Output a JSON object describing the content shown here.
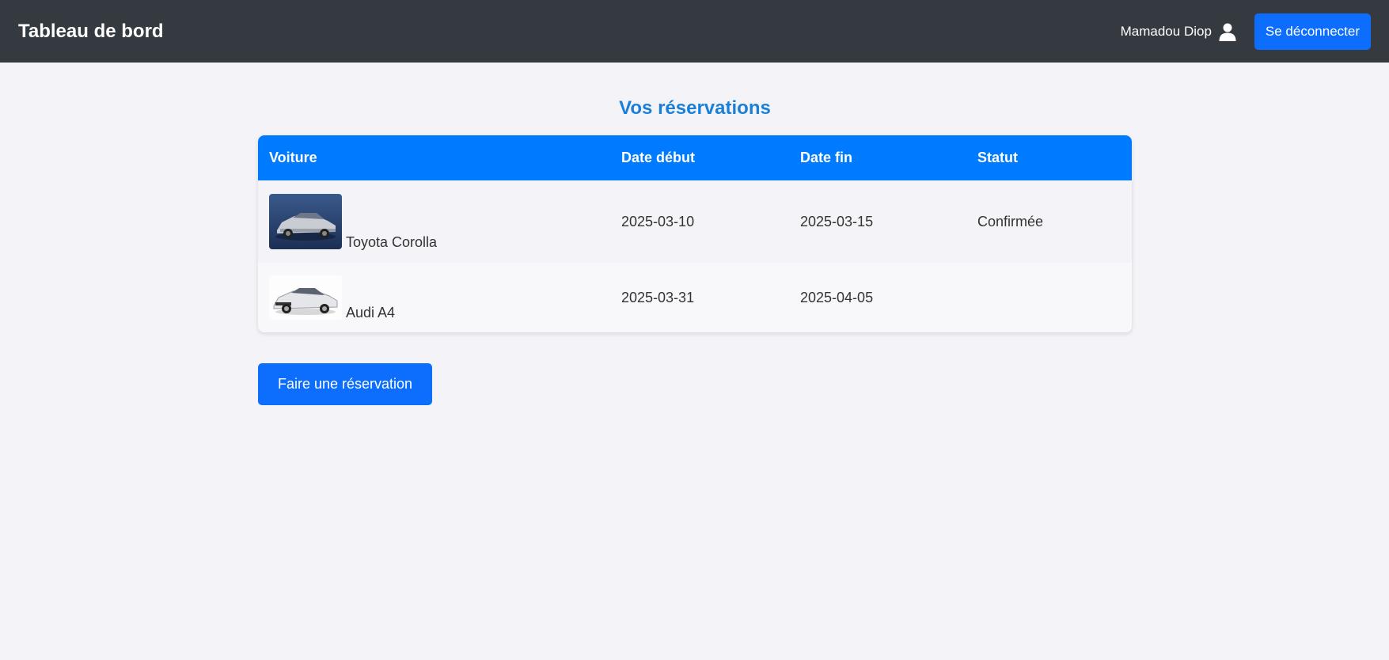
{
  "navbar": {
    "brand": "Tableau de bord",
    "user_name": "Mamadou Diop",
    "user_icon": "user-icon",
    "logout_label": "Se déconnecter"
  },
  "main": {
    "title": "Vos réservations",
    "table": {
      "headers": [
        "Voiture",
        "Date début",
        "Date fin",
        "Statut"
      ],
      "rows": [
        {
          "car": "Toyota Corolla",
          "start": "2025-03-10",
          "end": "2025-03-15",
          "status": "Confirmée"
        },
        {
          "car": "Audi A4",
          "start": "2025-03-31",
          "end": "2025-04-05",
          "status": ""
        }
      ]
    },
    "reserve_label": "Faire une réservation"
  },
  "colors": {
    "navbar_bg": "#343a40",
    "primary": "#007bff",
    "title": "#1a7fd6"
  }
}
